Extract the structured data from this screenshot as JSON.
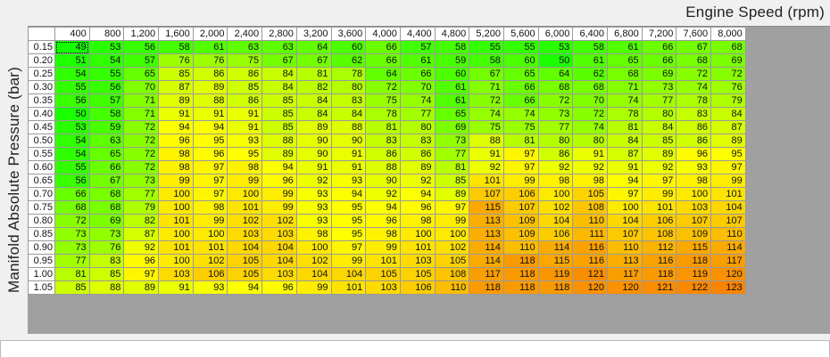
{
  "x_axis_title": "Engine Speed (rpm)",
  "y_axis_title": "Manifold Absolute Pressure (bar)",
  "columns": [
    "400",
    "800",
    "1,200",
    "1,600",
    "2,000",
    "2,400",
    "2,800",
    "3,200",
    "3,600",
    "4,000",
    "4,400",
    "4,800",
    "5,200",
    "5,600",
    "6,000",
    "6,400",
    "6,800",
    "7,200",
    "7,600",
    "8,000"
  ],
  "rows": [
    {
      "label": "0.15",
      "values": [
        49,
        53,
        56,
        58,
        61,
        63,
        63,
        64,
        60,
        66,
        57,
        58,
        55,
        55,
        53,
        58,
        61,
        66,
        67,
        68
      ]
    },
    {
      "label": "0.20",
      "values": [
        51,
        54,
        57,
        76,
        76,
        75,
        67,
        67,
        62,
        66,
        61,
        59,
        58,
        60,
        50,
        61,
        65,
        66,
        68,
        69
      ]
    },
    {
      "label": "0.25",
      "values": [
        54,
        55,
        65,
        85,
        86,
        86,
        84,
        81,
        78,
        64,
        66,
        60,
        67,
        65,
        64,
        62,
        68,
        69,
        72,
        72
      ]
    },
    {
      "label": "0.30",
      "values": [
        55,
        56,
        70,
        87,
        89,
        85,
        84,
        82,
        80,
        72,
        70,
        61,
        71,
        66,
        68,
        68,
        71,
        73,
        74,
        76
      ]
    },
    {
      "label": "0.35",
      "values": [
        56,
        57,
        71,
        89,
        88,
        86,
        85,
        84,
        83,
        75,
        74,
        61,
        72,
        66,
        72,
        70,
        74,
        77,
        78,
        79
      ]
    },
    {
      "label": "0.40",
      "values": [
        50,
        58,
        71,
        91,
        91,
        91,
        85,
        84,
        84,
        78,
        77,
        65,
        74,
        74,
        73,
        72,
        78,
        80,
        83,
        84
      ]
    },
    {
      "label": "0.45",
      "values": [
        53,
        59,
        72,
        94,
        94,
        91,
        85,
        89,
        88,
        81,
        80,
        69,
        75,
        75,
        77,
        74,
        81,
        84,
        86,
        87
      ]
    },
    {
      "label": "0.50",
      "values": [
        54,
        63,
        72,
        96,
        95,
        93,
        88,
        90,
        90,
        83,
        83,
        73,
        88,
        81,
        80,
        80,
        84,
        85,
        86,
        89
      ]
    },
    {
      "label": "0.55",
      "values": [
        54,
        65,
        72,
        98,
        96,
        95,
        89,
        90,
        91,
        86,
        86,
        77,
        91,
        97,
        86,
        91,
        87,
        89,
        96,
        95
      ]
    },
    {
      "label": "0.60",
      "values": [
        55,
        66,
        72,
        98,
        97,
        98,
        94,
        91,
        91,
        88,
        89,
        81,
        92,
        97,
        92,
        92,
        91,
        92,
        93,
        97
      ]
    },
    {
      "label": "0.65",
      "values": [
        56,
        67,
        73,
        99,
        97,
        99,
        96,
        92,
        93,
        90,
        92,
        85,
        101,
        99,
        98,
        98,
        94,
        97,
        98,
        99
      ]
    },
    {
      "label": "0.70",
      "values": [
        66,
        68,
        77,
        100,
        97,
        100,
        99,
        93,
        94,
        92,
        94,
        89,
        107,
        106,
        100,
        105,
        97,
        99,
        100,
        101
      ]
    },
    {
      "label": "0.75",
      "values": [
        68,
        68,
        79,
        100,
        98,
        101,
        99,
        93,
        95,
        94,
        96,
        97,
        115,
        107,
        102,
        108,
        100,
        101,
        103,
        104
      ]
    },
    {
      "label": "0.80",
      "values": [
        72,
        69,
        82,
        101,
        99,
        102,
        102,
        93,
        95,
        96,
        98,
        99,
        113,
        109,
        104,
        110,
        104,
        106,
        107,
        107
      ]
    },
    {
      "label": "0.85",
      "values": [
        73,
        73,
        87,
        100,
        100,
        103,
        103,
        98,
        95,
        98,
        100,
        100,
        113,
        109,
        106,
        111,
        107,
        108,
        109,
        110
      ]
    },
    {
      "label": "0.90",
      "values": [
        73,
        76,
        92,
        101,
        101,
        104,
        104,
        100,
        97,
        99,
        101,
        102,
        114,
        110,
        114,
        116,
        110,
        112,
        115,
        114
      ]
    },
    {
      "label": "0.95",
      "values": [
        77,
        83,
        96,
        100,
        102,
        105,
        104,
        102,
        99,
        101,
        103,
        105,
        114,
        118,
        115,
        116,
        113,
        116,
        118,
        117
      ]
    },
    {
      "label": "1.00",
      "values": [
        81,
        85,
        97,
        103,
        106,
        105,
        103,
        104,
        104,
        105,
        105,
        108,
        117,
        118,
        119,
        121,
        117,
        118,
        119,
        120
      ]
    },
    {
      "label": "1.05",
      "values": [
        85,
        88,
        89,
        91,
        93,
        94,
        96,
        99,
        101,
        103,
        106,
        110,
        118,
        118,
        118,
        120,
        120,
        121,
        122,
        123
      ]
    }
  ]
}
